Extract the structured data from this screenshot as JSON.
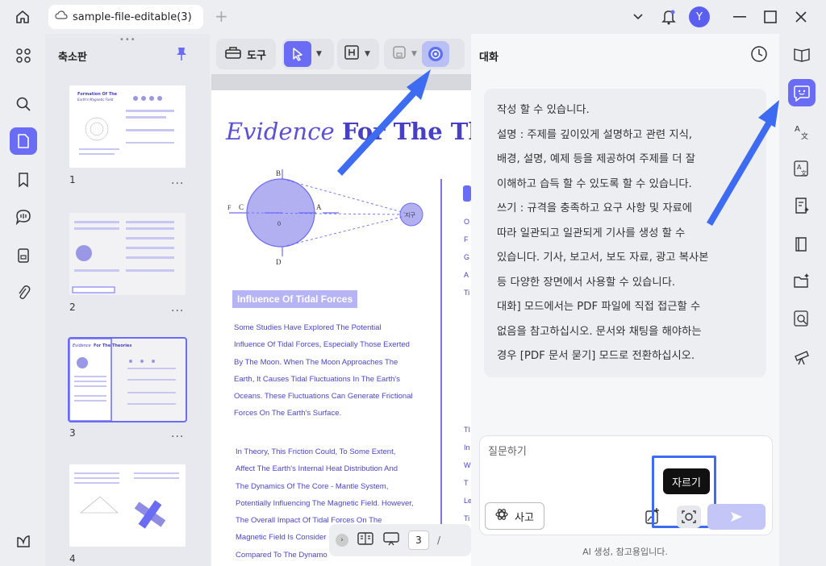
{
  "tab": {
    "title": "sample-file-editable(3)"
  },
  "user": {
    "avatar_letter": "Y"
  },
  "thumbnails": {
    "title": "축소판",
    "pages": [
      {
        "num": "1",
        "heading": "Formation Of The Earth's Magnetic Field"
      },
      {
        "num": "2"
      },
      {
        "num": "3",
        "heading": "Evidence For The Theories"
      },
      {
        "num": "4"
      }
    ],
    "more": "..."
  },
  "toolbar": {
    "tool_label": "도구"
  },
  "document": {
    "title_italic": "Evidence",
    "title_bold": "For The Theo",
    "section_badge": "Influence Of Tidal Forces",
    "para1": [
      "Some Studies Have Explored The Potential",
      "Influence Of Tidal Forces, Especially Those Exerted",
      "By The Moon. When The Moon Approaches The",
      "Earth, It Causes Tidal Fluctuations In The Earth's",
      "Oceans. These Fluctuations Can Generate Frictional",
      "Forces On The Earth's Surface."
    ],
    "para2": [
      "In Theory, This Friction Could, To Some Extent,",
      "Affect The Earth's Internal Heat Distribution And",
      "The Dynamics Of The Core - Mantle System,",
      "Potentially Influencing The Magnetic Field. However,",
      "The Overall Impact Of Tidal Forces On The",
      "Magnetic Field Is Consider",
      "Compared To The Dynamo"
    ],
    "side_letters": [
      "O",
      "F",
      "G",
      "A",
      "Ti",
      "TI",
      "In",
      "W",
      "T",
      "Le",
      "Ti"
    ],
    "diagram_labels": {
      "B": "B",
      "D": "D",
      "A": "A",
      "C": "C",
      "F": "F",
      "O": "0",
      "earth": "지구"
    }
  },
  "pager": {
    "current_page": "3",
    "separator": "/"
  },
  "chat": {
    "title": "대화",
    "message_lines": [
      "작성 할 수 있습니다.",
      "설명 : 주제를 깊이있게 설명하고 관련 지식,",
      "배경, 설명, 예제 등을 제공하여 주제를 더 잘",
      "이해하고 습득 할 수 있도록 할 수 있습니다.",
      "쓰기 : 규격을 충족하고 요구 사항 및 자료에",
      "따라 일관되고 일관되게 기사를 생성 할 수",
      "있습니다. 기사, 보고서, 보도 자료, 광고 복사본",
      "등 다양한 장면에서 사용할 수 있습니다.",
      "대화] 모드에서는 PDF 파일에 직접 접근할 수",
      "없음을 참고하십시오. 문서와 채팅을 해야하는",
      "경우 [PDF 문서 묻기] 모드로 전환하십시오."
    ],
    "input_placeholder": "질문하기",
    "think_label": "사고",
    "crop_tooltip": "자르기",
    "footnote": "AI 생성, 참고용입니다."
  },
  "colors": {
    "accent": "#6b6cf5",
    "arrow": "#3d6bf2",
    "doc_text": "#4a45c9"
  }
}
